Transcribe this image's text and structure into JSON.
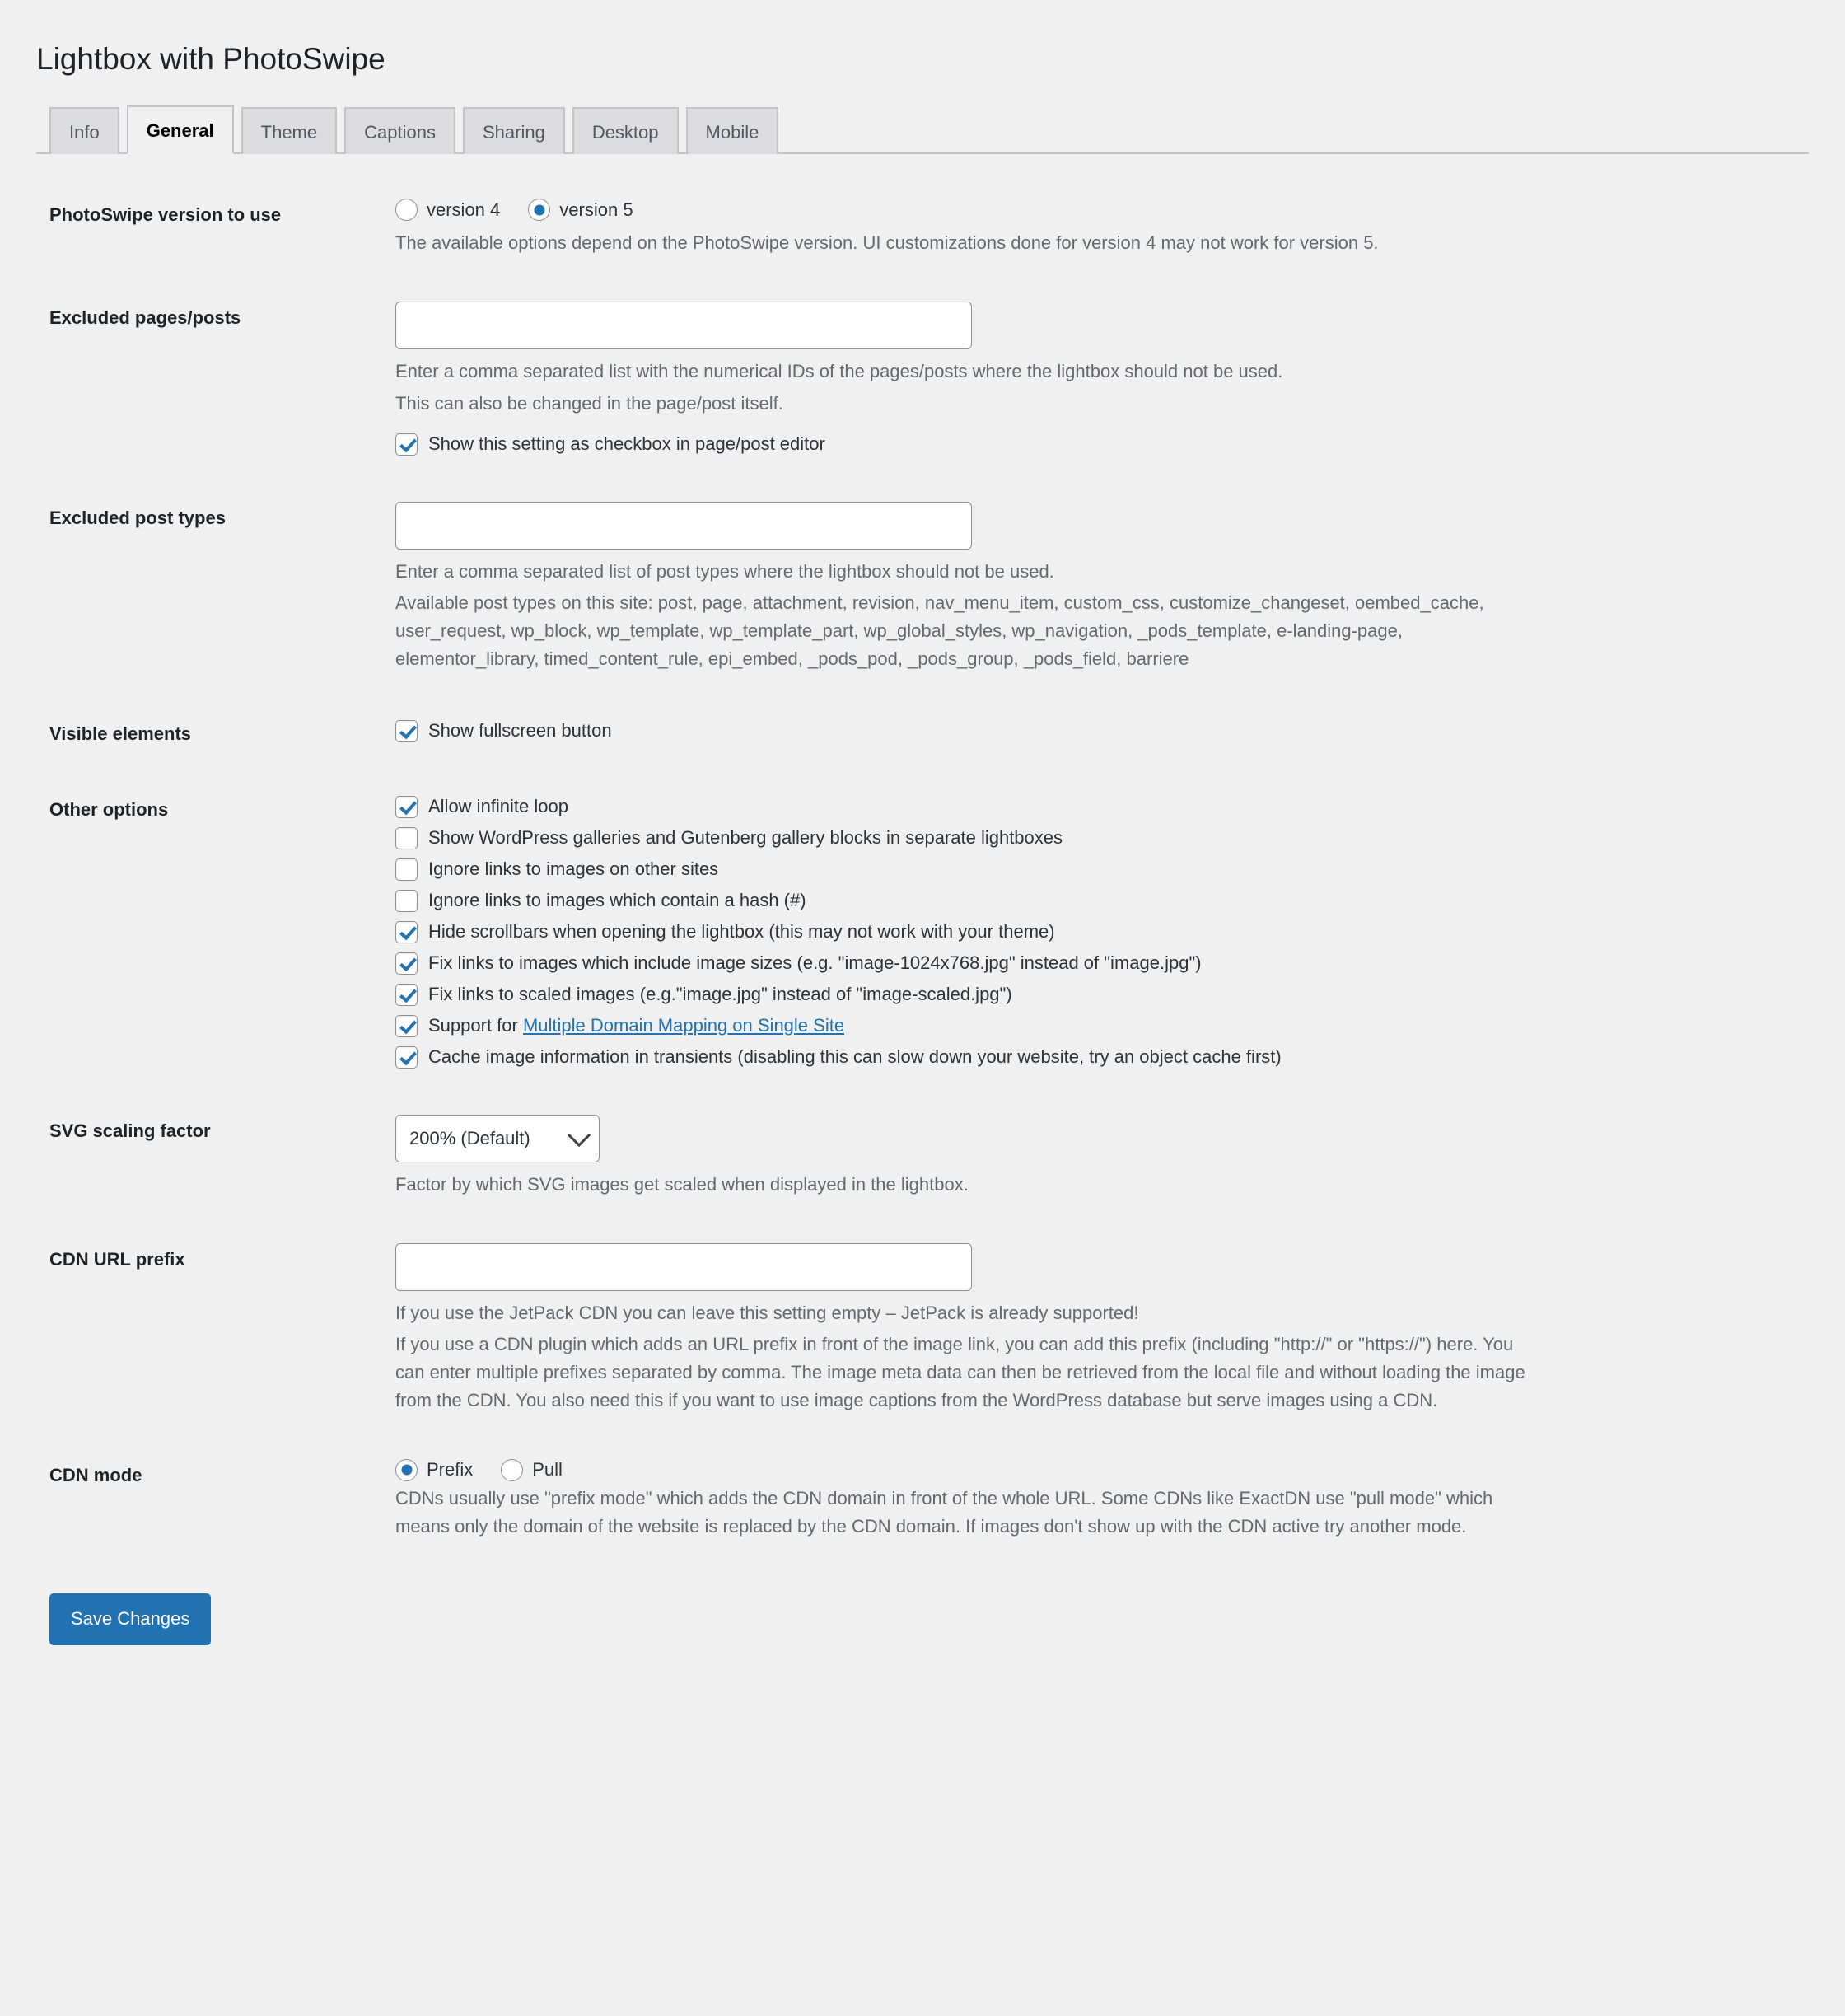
{
  "page": {
    "title": "Lightbox with PhotoSwipe"
  },
  "tabs": [
    {
      "label": "Info",
      "active": false
    },
    {
      "label": "General",
      "active": true
    },
    {
      "label": "Theme",
      "active": false
    },
    {
      "label": "Captions",
      "active": false
    },
    {
      "label": "Sharing",
      "active": false
    },
    {
      "label": "Desktop",
      "active": false
    },
    {
      "label": "Mobile",
      "active": false
    }
  ],
  "settings": {
    "version": {
      "label": "PhotoSwipe version to use",
      "options": [
        {
          "label": "version 4",
          "selected": false
        },
        {
          "label": "version 5",
          "selected": true
        }
      ],
      "description": "The available options depend on the PhotoSwipe version. UI customizations done for version 4 may not work for version 5."
    },
    "excluded_pages": {
      "label": "Excluded pages/posts",
      "value": "",
      "description_line1": "Enter a comma separated list with the numerical IDs of the pages/posts where the lightbox should not be used.",
      "description_line2": "This can also be changed in the page/post itself.",
      "checkbox": {
        "label": "Show this setting as checkbox in page/post editor",
        "checked": true
      }
    },
    "excluded_post_types": {
      "label": "Excluded post types",
      "value": "",
      "description": "Enter a comma separated list of post types where the lightbox should not be used.",
      "available_intro": "Available post types on this site:",
      "available_list": "post, page, attachment, revision, nav_menu_item, custom_css, customize_changeset, oembed_cache, user_request, wp_block, wp_template, wp_template_part, wp_global_styles, wp_navigation, _pods_template, e-landing-page, elementor_library, timed_content_rule, epi_embed, _pods_pod, _pods_group, _pods_field, barriere"
    },
    "visible_elements": {
      "label": "Visible elements",
      "options": [
        {
          "label": "Show fullscreen button",
          "checked": true
        }
      ]
    },
    "other_options": {
      "label": "Other options",
      "options": [
        {
          "label": "Allow infinite loop",
          "checked": true
        },
        {
          "label": "Show WordPress galleries and Gutenberg gallery blocks in separate lightboxes",
          "checked": false
        },
        {
          "label": "Ignore links to images on other sites",
          "checked": false
        },
        {
          "label": "Ignore links to images which contain a hash (#)",
          "checked": false
        },
        {
          "label": "Hide scrollbars when opening the lightbox (this may not work with your theme)",
          "checked": true
        },
        {
          "label": "Fix links to images which include image sizes (e.g. \"image-1024x768.jpg\" instead of \"image.jpg\")",
          "checked": true
        },
        {
          "label": "Fix links to scaled images (e.g.\"image.jpg\" instead of \"image-scaled.jpg\")",
          "checked": true
        },
        {
          "label": "Support for ",
          "link_text": "Multiple Domain Mapping on Single Site",
          "checked": true,
          "has_link": true
        },
        {
          "label": "Cache image information in transients (disabling this can slow down your website, try an object cache first)",
          "checked": true
        }
      ]
    },
    "svg_scaling": {
      "label": "SVG scaling factor",
      "selected": "200% (Default)",
      "description": "Factor by which SVG images get scaled when displayed in the lightbox."
    },
    "cdn_url_prefix": {
      "label": "CDN URL prefix",
      "value": "",
      "description_line1": "If you use the JetPack CDN you can leave this setting empty – JetPack is already supported!",
      "description_line2": "If you use a CDN plugin which adds an URL prefix in front of the image link, you can add this prefix (including \"http://\" or \"https://\") here. You can enter multiple prefixes separated by comma. The image meta data can then be retrieved from the local file and without loading the image from the CDN. You also need this if you want to use image captions from the WordPress database but serve images using a CDN."
    },
    "cdn_mode": {
      "label": "CDN mode",
      "options": [
        {
          "label": "Prefix",
          "selected": true
        },
        {
          "label": "Pull",
          "selected": false
        }
      ],
      "description": "CDNs usually use \"prefix mode\" which adds the CDN domain in front of the whole URL. Some CDNs like ExactDN use \"pull mode\" which means only the domain of the website is replaced by the CDN domain. If images don't show up with the CDN active try another mode."
    }
  },
  "submit": {
    "label": "Save Changes"
  },
  "colors": {
    "accent": "#2271b1",
    "page_bg": "#f0f0f1",
    "tab_bg": "#dcdcde",
    "border": "#c3c4c7",
    "text": "#1d2327",
    "muted_text": "#646970"
  }
}
